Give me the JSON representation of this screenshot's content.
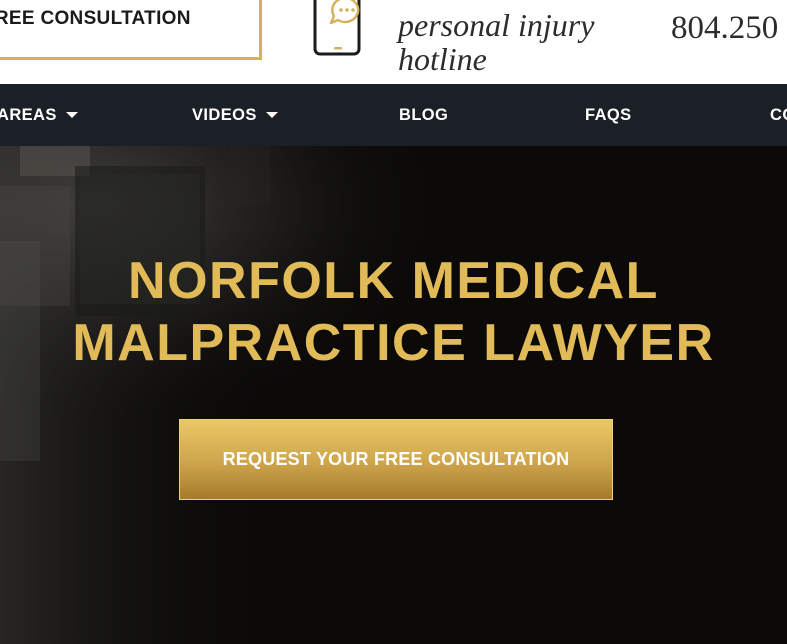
{
  "header": {
    "consultation_label": "FREE CONSULTATION",
    "hotline_line1": "personal injury",
    "hotline_line2": "hotline",
    "phone_number": "804.250",
    "phone_icon": "phone-chat-icon",
    "accent_color": "#d3b25b"
  },
  "nav": {
    "items": [
      {
        "label": "AREAS",
        "has_dropdown": true
      },
      {
        "label": "VIDEOS",
        "has_dropdown": true
      },
      {
        "label": "BLOG",
        "has_dropdown": false
      },
      {
        "label": "FAQS",
        "has_dropdown": false
      },
      {
        "label": "CO",
        "has_dropdown": false
      }
    ],
    "background_color": "#1b1f26"
  },
  "hero": {
    "title_line1": "NORFOLK MEDICAL",
    "title_line2": "MALPRACTICE LAWYER",
    "cta_label": "REQUEST YOUR FREE CONSULTATION",
    "title_color": "#e2bb59"
  }
}
